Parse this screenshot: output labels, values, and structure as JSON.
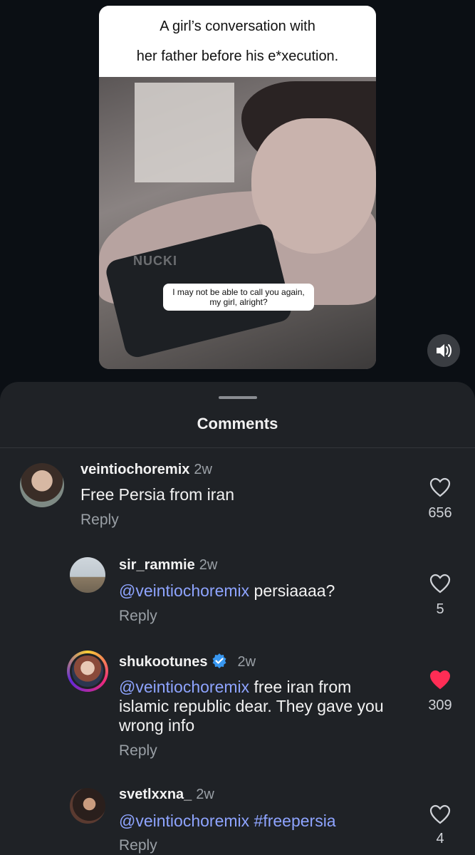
{
  "video": {
    "title_line1": "A girl’s conversation with",
    "title_line2": "her father before his e*xecution.",
    "caption_line1": "I may not be able to call you again,",
    "caption_line2": "my girl, alright?",
    "watermark": "NUCKI",
    "sound_icon": "speaker-icon"
  },
  "panel": {
    "title": "Comments"
  },
  "comments": [
    {
      "username": "veintiochoremix",
      "time": "2w",
      "text": "Free Persia from iran",
      "reply": "Reply",
      "likes": "656",
      "liked": false
    },
    {
      "username": "sir_rammie",
      "time": "2w",
      "mention": "@veintiochoremix",
      "text": " persiaaaa?",
      "reply": "Reply",
      "likes": "5",
      "liked": false
    },
    {
      "username": "shukootunes",
      "verified": true,
      "time": "2w",
      "mention": "@veintiochoremix",
      "text_line1": " free iran from",
      "text_line2": "islamic republic dear. They gave you",
      "text_line3": "wrong info",
      "reply": "Reply",
      "likes": "309",
      "liked": true
    },
    {
      "username": "svetlxxna_",
      "time": "2w",
      "mention": "@veintiochoremix",
      "text": " #freepersia",
      "reply": "Reply",
      "likes": "4",
      "liked": false
    }
  ],
  "colors": {
    "accent_mention": "#8ea4ff",
    "heart_liked": "#ff2d55",
    "verified": "#3897f0"
  }
}
